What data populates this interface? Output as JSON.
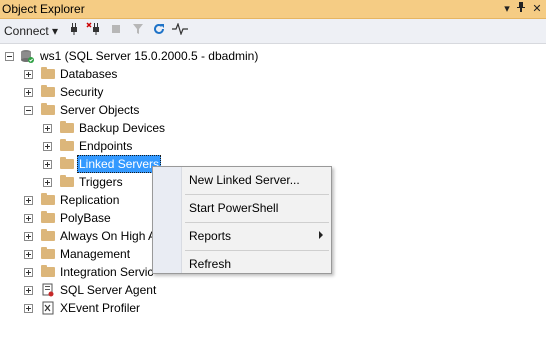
{
  "window": {
    "title": "Object Explorer",
    "pin_glyph": "▾",
    "dock_glyph": "⌕",
    "close_glyph": "✕"
  },
  "toolbar": {
    "connect_label": "Connect ▾"
  },
  "tree": {
    "root": "ws1 (SQL Server 15.0.2000.5 - dbadmin)",
    "databases": "Databases",
    "security": "Security",
    "server_objects": "Server Objects",
    "backup_devices": "Backup Devices",
    "endpoints": "Endpoints",
    "linked_servers": "Linked Servers",
    "triggers": "Triggers",
    "replication": "Replication",
    "polybase": "PolyBase",
    "always_on": "Always On High A",
    "management": "Management",
    "integration": "Integration Servic",
    "agent": "SQL Server Agent",
    "xevent": "XEvent Profiler"
  },
  "context_menu": {
    "new_linked_server": "New Linked Server...",
    "start_powershell": "Start PowerShell",
    "reports": "Reports",
    "refresh": "Refresh"
  }
}
